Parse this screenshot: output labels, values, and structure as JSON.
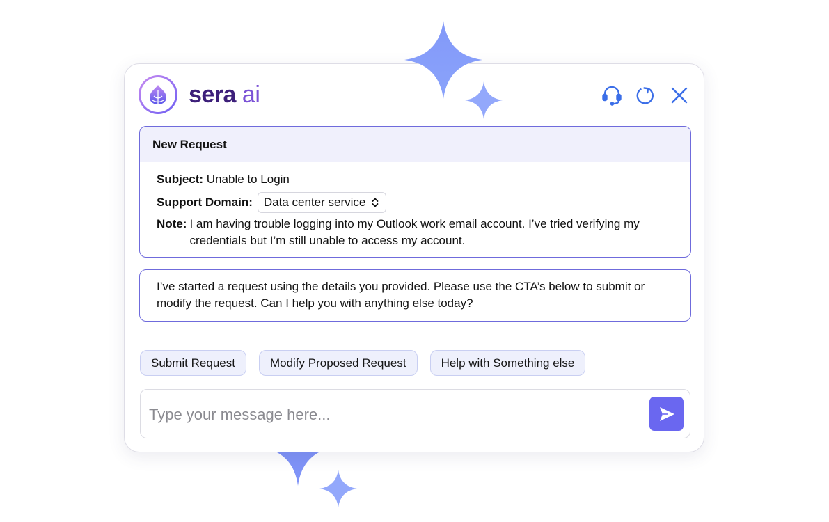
{
  "brand": {
    "name": "sera",
    "suffix": "ai"
  },
  "header_actions": [
    "headset-icon",
    "refresh-icon",
    "close-icon"
  ],
  "request": {
    "title": "New Request",
    "subject_label": "Subject:",
    "subject_value": "Unable to Login",
    "domain_label": "Support Domain:",
    "domain_value": "Data center service",
    "note_label": "Note:",
    "note_value": "I am having trouble logging into my Outlook work email account. I’ve tried verifying my credentials but I’m still unable to access my account."
  },
  "assistant_message": "I’ve started a request using the details you provided. Please use the CTA’s below to submit or modify the request. Can I help you with anything else today?",
  "ctas": [
    "Submit Request",
    "Modify Proposed Request",
    "Help with Something else"
  ],
  "composer": {
    "placeholder": "Type your message here..."
  },
  "colors": {
    "accent": "#6a67f0",
    "border": "#6f6bdc",
    "brand": "#3d1f7a",
    "sparkle": "#7f93f7"
  }
}
